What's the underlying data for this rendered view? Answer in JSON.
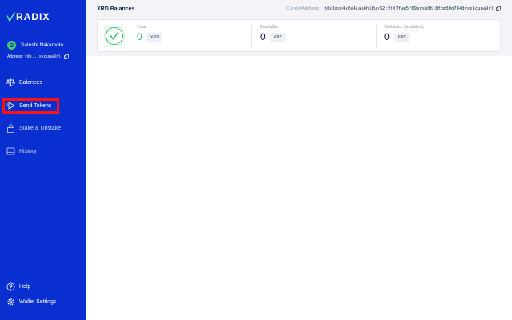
{
  "app": {
    "logo_text": "RADIX"
  },
  "user": {
    "name": "Satoshi Nakamoto",
    "address_label": "Address:",
    "address_short": "tdx...skcupa9rl"
  },
  "nav": {
    "balances": "Balances",
    "send_tokens": "Send Tokens",
    "stake_unstake": "Stake & Unstake",
    "history": "History",
    "help": "Help",
    "wallet_settings": "Wallet Settings"
  },
  "header": {
    "title": "XRD Balances",
    "current_address_label": "Current Address:",
    "current_address": "tdx1qsp4x6e4uaakh58uy92tfj07fae5f69nrsn0hl8fxm30g784dvxskcupa9rl"
  },
  "balances": {
    "total": {
      "label": "Total",
      "value": "0",
      "unit": "XRD"
    },
    "available": {
      "label": "Available",
      "value": "0",
      "unit": "XRD"
    },
    "staked": {
      "label": "Staked or Unstaking",
      "value": "0",
      "unit": "XRD"
    }
  },
  "colors": {
    "sidebar": "#0a2fd0",
    "highlight": "#ff1212",
    "accent_green": "#2ec26b"
  }
}
